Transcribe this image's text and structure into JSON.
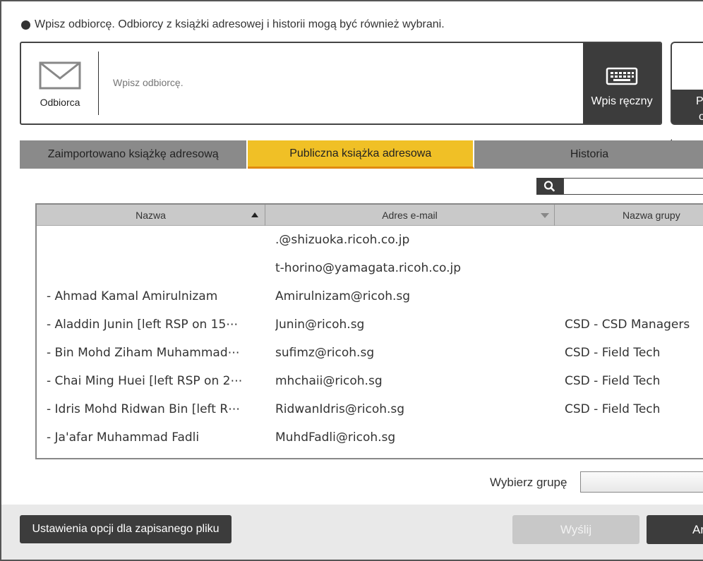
{
  "instruction": "Wpisz odbiorcę. Odbiorcy z książki adresowej i historii mogą być również wybrani.",
  "recipient": {
    "label": "Odbiorca",
    "placeholder": "Wpisz odbiorcę.",
    "manual_label": "Wpis ręczny",
    "side_text_1": "Po",
    "side_text_2": "o"
  },
  "tabs": [
    {
      "label": "Zaimportowano książkę adresową",
      "active": false
    },
    {
      "label": "Publiczna książka adresowa",
      "active": true
    },
    {
      "label": "Historia",
      "active": false
    }
  ],
  "table": {
    "headers": {
      "name": "Nazwa",
      "email": "Adres e-mail",
      "group": "Nazwa grupy"
    },
    "rows": [
      {
        "name": "",
        "email": ".@shizuoka.ricoh.co.jp",
        "group": ""
      },
      {
        "name": "",
        "email": "t-horino@yamagata.ricoh.co.jp",
        "group": ""
      },
      {
        "name": "- Ahmad Kamal Amirulnizam",
        "email": "Amirulnizam@ricoh.sg",
        "group": ""
      },
      {
        "name": "- Aladdin Junin [left RSP on 15⋯",
        "email": "Junin@ricoh.sg",
        "group": "CSD - CSD Managers"
      },
      {
        "name": "- Bin Mohd Ziham Muhammad⋯",
        "email": "sufimz@ricoh.sg",
        "group": "CSD - Field Tech"
      },
      {
        "name": "- Chai Ming Huei [left RSP on 2⋯",
        "email": "mhchaii@ricoh.sg",
        "group": "CSD - Field Tech"
      },
      {
        "name": "- Idris Mohd Ridwan Bin [left R⋯",
        "email": "RidwanIdris@ricoh.sg",
        "group": "CSD - Field Tech"
      },
      {
        "name": "- Ja'afar Muhammad Fadli",
        "email": "MuhdFadli@ricoh.sg",
        "group": ""
      }
    ]
  },
  "group_select_label": "Wybierz grupę",
  "buttons": {
    "options": "Ustawienia opcji dla zapisanego pliku",
    "send": "Wyślij",
    "cancel": "Ar"
  },
  "colors": {
    "active_tab": "#f0c026",
    "active_tab_underline": "#e08a10",
    "dark_button": "#3c3c3c",
    "inactive_tab": "#8a8a8a"
  },
  "icons": [
    "envelope-icon",
    "keyboard-icon",
    "search-icon",
    "sort-ascending-icon",
    "sort-descending-icon"
  ]
}
